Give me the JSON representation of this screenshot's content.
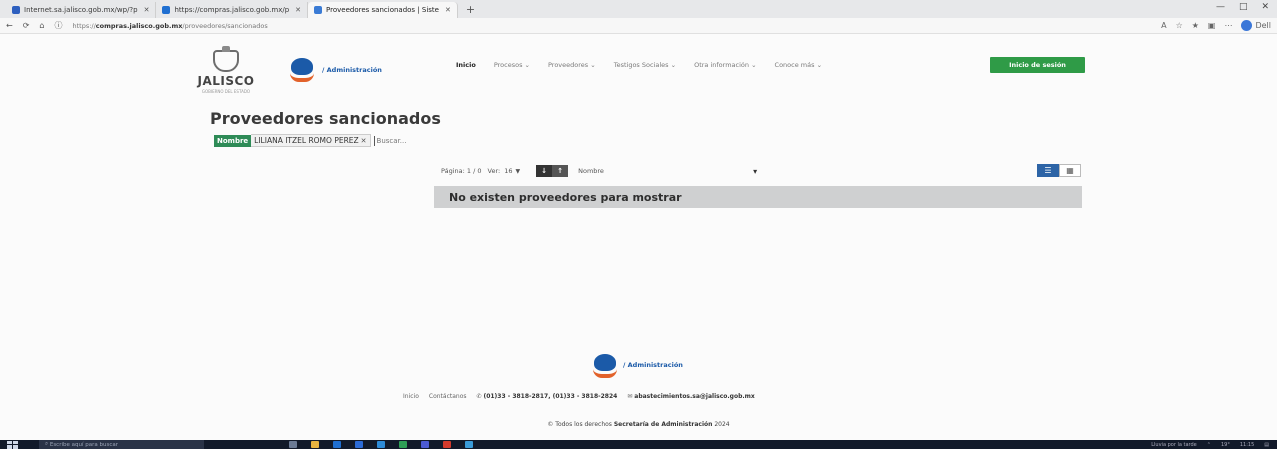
{
  "browser": {
    "tabs": [
      {
        "title": "Internet.sa.jalisco.gob.mx/wp/?p",
        "color": "#2d5fbf",
        "active": false
      },
      {
        "title": "https://compras.jalisco.gob.mx/p",
        "color": "#1f6fd1",
        "active": false
      },
      {
        "title": "Proveedores sancionados | Siste",
        "color": "#3a7bd5",
        "active": true
      }
    ],
    "new_tab": "+",
    "url_host": "compras.jalisco.gob.mx",
    "url_prefix": "https://",
    "url_path": "/proveedores/sancionados",
    "profile": "Dell"
  },
  "header": {
    "jalisco_name": "JALISCO",
    "jalisco_sub": "GOBIERNO DEL ESTADO",
    "admin_label": "/ Administración",
    "nav": [
      "Inicio",
      "Procesos",
      "Proveedores",
      "Testigos Sociales",
      "Otra información",
      "Conoce más"
    ],
    "login": "Inicio de sesión"
  },
  "main": {
    "title": "Proveedores sancionados",
    "filter": {
      "key": "Nombre",
      "value": "LILIANA ITZEL ROMO PEREZ",
      "placeholder": "Buscar..."
    },
    "toolbar": {
      "page_label": "Página: 1 / 0",
      "per_label": "Ver:",
      "per_value": "16",
      "sort_asc": "↓",
      "sort_desc": "↑",
      "sort_field": "Nombre"
    },
    "empty_message": "No existen proveedores para mostrar"
  },
  "footer": {
    "admin_label": "/ Administración",
    "link_home": "Inicio",
    "link_contact": "Contáctanos",
    "phones": "(01)33 - 3818-2817, (01)33 - 3818-2824",
    "email": "abastecimientos.sa@jalisco.gob.mx",
    "copyright_prefix": "© Todos los derechos",
    "copyright_org": "Secretaría de Administración",
    "copyright_year": "2024"
  },
  "taskbar": {
    "search_placeholder": "Escribe aquí para buscar",
    "weather": "Lluvia por la tarde",
    "temperature": "19°",
    "time": "11:15"
  }
}
